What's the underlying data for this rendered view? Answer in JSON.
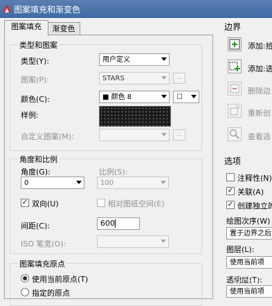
{
  "window": {
    "title": "图案填充和渐变色"
  },
  "tabs": [
    {
      "label": "图案填充",
      "active": true
    },
    {
      "label": "渐变色",
      "active": false
    }
  ],
  "type_pattern": {
    "group_label": "类型和图案",
    "type_label": "类型(Y):",
    "type_value": "用户定义",
    "pattern_label": "图案(P):",
    "pattern_value": "STARS",
    "color_label": "颜色(C):",
    "color_value": "■ 颜色 8",
    "bgcolor_value": "☐",
    "sample_label": "样例:",
    "custom_label": "自定义图案(M):",
    "custom_value": "",
    "ellipsis": "..."
  },
  "angle_scale": {
    "group_label": "角度和比例",
    "angle_label": "角度(G):",
    "angle_value": "0",
    "scale_label": "比例(S):",
    "scale_value": "100",
    "double_label": "双向(U)",
    "double_checked": true,
    "paper_label": "相对图纸空间(E)",
    "paper_checked": false,
    "spacing_label": "间距(C):",
    "spacing_value": "600",
    "iso_label": "ISO 笔宽(O):",
    "iso_value": ""
  },
  "origin": {
    "group_label": "图案填充原点",
    "use_current_label": "使用当前原点(T)",
    "specified_label": "指定的原点"
  },
  "boundary": {
    "group_label": "边界",
    "add_pick_label": "添加:拾",
    "add_select_label": "添加:选",
    "remove_label": "删除边",
    "recreate_label": "重新创",
    "view_label": "查看选"
  },
  "options": {
    "group_label": "选项",
    "annotative_label": "注释性(N)",
    "annotative_checked": false,
    "associative_label": "关联(A)",
    "associative_checked": true,
    "independent_label": "创建独立的",
    "independent_checked": true,
    "draw_order_label": "绘图次序(W)",
    "draw_order_value": "置于边界之后",
    "layer_label": "图层(L):",
    "layer_value": "使用当前项",
    "transparency_label": "透明度(T):",
    "transparency_value": "使用当前项"
  },
  "watermark": "©CAD之"
}
